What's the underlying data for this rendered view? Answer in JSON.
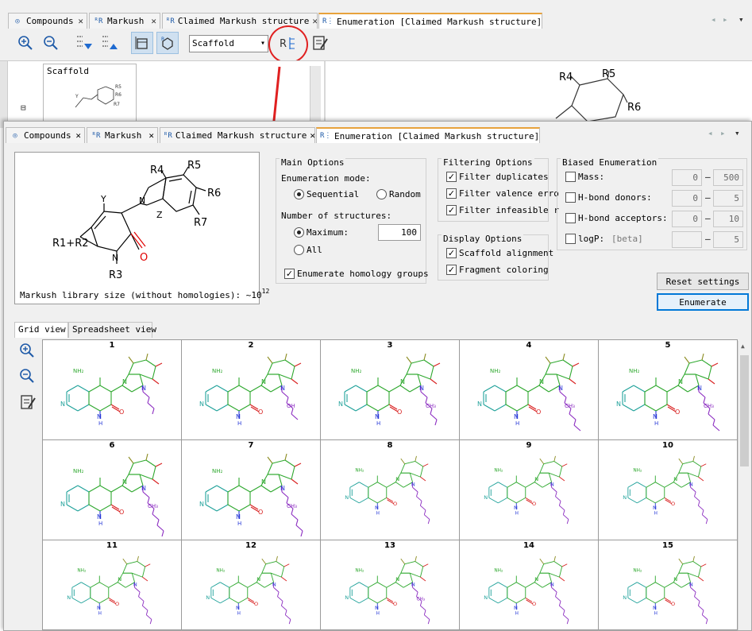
{
  "bg_window": {
    "tabs": [
      {
        "label": "Compounds",
        "icon": "compounds-icon"
      },
      {
        "label": "Markush",
        "icon": "markush-icon"
      },
      {
        "label": "Claimed Markush structure",
        "icon": "markush-icon"
      },
      {
        "label": "Enumeration [Claimed Markush structure]",
        "icon": "enumeration-icon"
      }
    ],
    "close_glyph": "✕",
    "scaffold_select": "Scaffold",
    "scaffold_panel_title": "Scaffold",
    "tree_toggle": "⊟",
    "r_labels": [
      "R4",
      "R5",
      "R6"
    ],
    "small_r_labels": [
      "R5",
      "R6",
      "R7"
    ],
    "y_label": "Y"
  },
  "fg_window": {
    "tabs": [
      {
        "label": "Compounds",
        "icon": "compounds-icon"
      },
      {
        "label": "Markush",
        "icon": "markush-icon"
      },
      {
        "label": "Claimed Markush structure",
        "icon": "markush-icon"
      },
      {
        "label": "Enumeration [Claimed Markush structure]",
        "icon": "enumeration-icon"
      }
    ],
    "close_glyph": "✕",
    "preview": {
      "atom_labels": {
        "r4": "R4",
        "r5": "R5",
        "r6": "R6",
        "r7": "R7",
        "y": "Y",
        "z": "Z",
        "r1r2": "R1+R2",
        "n": "N",
        "o": "O",
        "r3": "R3"
      },
      "lib_size_text": "Markush library size (without homologies): ~10",
      "lib_size_exp": "12"
    },
    "main_options": {
      "title": "Main Options",
      "enum_mode_label": "Enumeration mode:",
      "sequential": "Sequential",
      "random": "Random",
      "num_structures_label": "Number of structures:",
      "maximum": "Maximum:",
      "maximum_value": "100",
      "all": "All",
      "enumerate_homology": "Enumerate homology groups"
    },
    "filtering_options": {
      "title": "Filtering Options",
      "filter_duplicates": "Filter duplicates",
      "filter_valence": "Filter valence erro",
      "filter_infeasible": "Filter infeasible r"
    },
    "display_options": {
      "title": "Display Options",
      "scaffold_alignment": "Scaffold alignment",
      "fragment_coloring": "Fragment coloring"
    },
    "biased_enumeration": {
      "title": "Biased Enumeration",
      "mass": {
        "label": "Mass:",
        "min": "0",
        "max": "500"
      },
      "hbond_donors": {
        "label": "H-bond donors:",
        "min": "0",
        "max": "5"
      },
      "hbond_acceptors": {
        "label": "H-bond acceptors:",
        "min": "0",
        "max": "10"
      },
      "logp": {
        "label": "logP:",
        "beta": "[beta]",
        "min": "",
        "max": "5"
      },
      "dash": "–"
    },
    "reset_settings": "Reset settings",
    "enumerate": "Enumerate",
    "view_tabs": [
      "Grid view",
      "Spreadsheet view"
    ],
    "grid_numbers": [
      "1",
      "2",
      "3",
      "4",
      "5",
      "6",
      "7",
      "8",
      "9",
      "10",
      "11",
      "12",
      "13",
      "14",
      "15"
    ],
    "mol_labels": {
      "nh2": "NH₂",
      "n": "N",
      "h": "H",
      "o": "O",
      "oh": "OH",
      "ch3": "CH₃"
    }
  }
}
